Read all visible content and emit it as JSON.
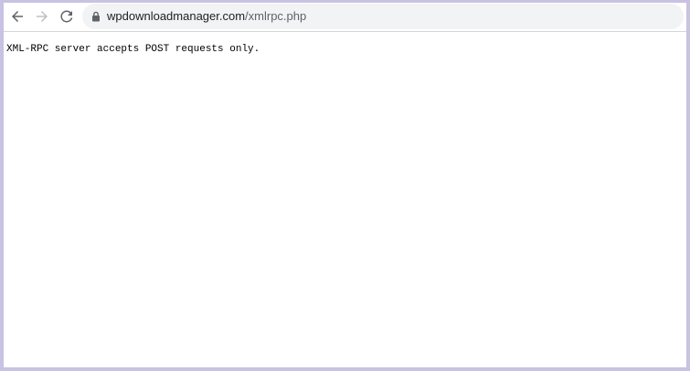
{
  "toolbar": {
    "back_icon": "arrow-left-icon",
    "forward_icon": "arrow-right-icon",
    "reload_icon": "reload-icon",
    "lock_icon": "lock-icon"
  },
  "address_bar": {
    "domain": "wpdownloadmanager.com",
    "path": "/xmlrpc.php"
  },
  "page": {
    "message": "XML-RPC server accepts POST requests only."
  },
  "colors": {
    "frame_border": "#c9c2e3",
    "omnibox_background": "#f1f3f4",
    "icon_active": "#5f6368",
    "icon_disabled": "#bdc1c6"
  }
}
